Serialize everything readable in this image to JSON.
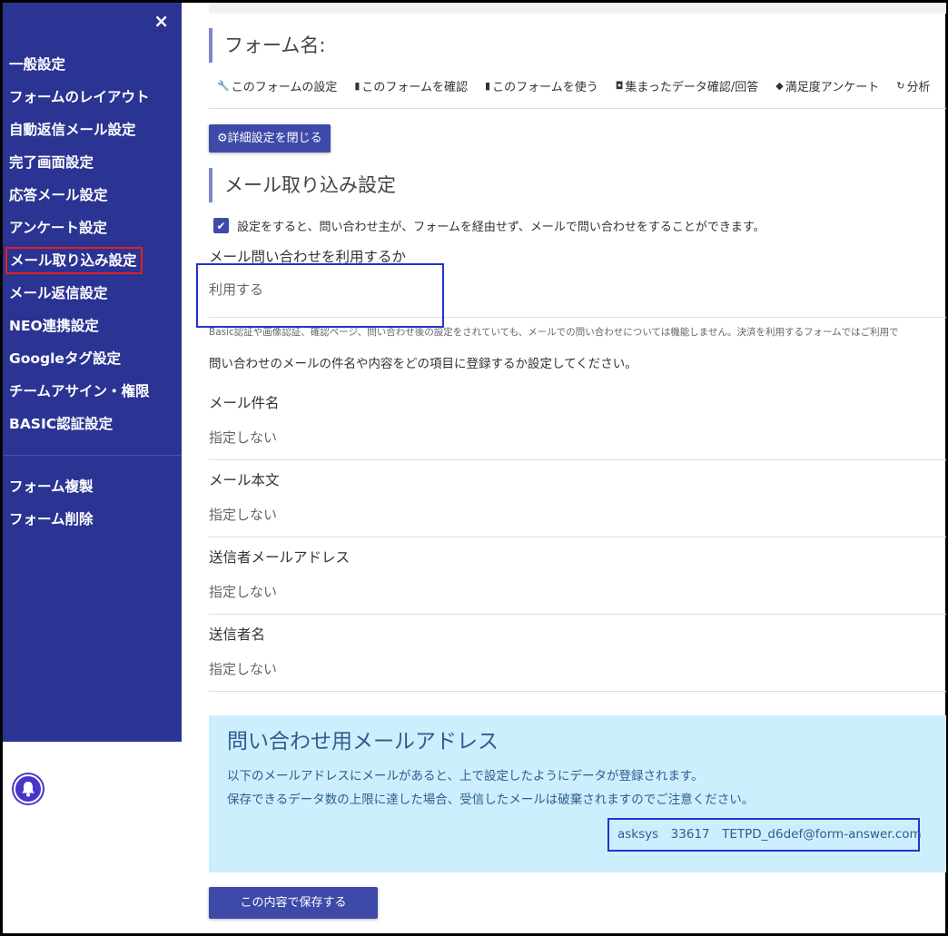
{
  "sidebar": {
    "close_label": "×",
    "items": [
      {
        "label": "一般設定"
      },
      {
        "label": "フォームのレイアウト"
      },
      {
        "label": "自動返信メール設定"
      },
      {
        "label": "完了画面設定"
      },
      {
        "label": "応答メール設定"
      },
      {
        "label": "アンケート設定"
      },
      {
        "label": "メール取り込み設定"
      },
      {
        "label": "メール返信設定"
      },
      {
        "label": "NEO連携設定"
      },
      {
        "label": "Googleタグ設定"
      },
      {
        "label": "チームアサイン・権限"
      },
      {
        "label": "BASIC認証設定"
      }
    ],
    "bottom_items": [
      {
        "label": "フォーム複製"
      },
      {
        "label": "フォーム削除"
      }
    ],
    "active_index": 6
  },
  "header": {
    "form_title": "フォーム名:",
    "links": [
      {
        "icon": "wrench-icon",
        "glyph": "🔧",
        "label": "このフォームの設定"
      },
      {
        "icon": "document-icon",
        "glyph": "▮",
        "label": "このフォームを確認"
      },
      {
        "icon": "document-icon",
        "glyph": "▮",
        "label": "このフォームを使う"
      },
      {
        "icon": "comment-icon",
        "glyph": "◘",
        "label": "集まったデータ確認/回答"
      },
      {
        "icon": "layers-icon",
        "glyph": "◆",
        "label": "満足度アンケート"
      },
      {
        "icon": "refresh-icon",
        "glyph": "↻",
        "label": "分析"
      }
    ],
    "close_detail_button": "⚙詳細設定を閉じる"
  },
  "mail_import": {
    "section_title": "メール取り込み設定",
    "checkbox_label": "設定をすると、問い合わせ主が、フォームを経由せず、メールで問い合わせをすることができます。",
    "use_label": "メール問い合わせを利用するか",
    "use_value": "利用する",
    "note": "Basic認証や画像認証、確認ページ、問い合わせ後の設定をされていても、メールでの問い合わせについては機能しません。決済を利用するフォームではご利用で",
    "instruction": "問い合わせのメールの件名や内容をどの項目に登録するか設定してください。",
    "fields": [
      {
        "label": "メール件名",
        "value": "指定しない"
      },
      {
        "label": "メール本文",
        "value": "指定しない"
      },
      {
        "label": "送信者メールアドレス",
        "value": "指定しない"
      },
      {
        "label": "送信者名",
        "value": "指定しない"
      }
    ]
  },
  "info": {
    "title": "問い合わせ用メールアドレス",
    "line1": "以下のメールアドレスにメールがあると、上で設定したようにデータが登録されます。",
    "line2": "保存できるデータ数の上限に達した場合、受信したメールは破棄されますのでご注意ください。",
    "address": "asksys　33617　TETPD_d6def@form-answer.com"
  },
  "save_button": "この内容で保存する",
  "colors": {
    "sidebar_bg": "#2b3493",
    "button_bg": "#3e4aa8",
    "info_bg": "#cdeefc",
    "highlight_red": "#e02020",
    "highlight_blue": "#1d36d1"
  }
}
